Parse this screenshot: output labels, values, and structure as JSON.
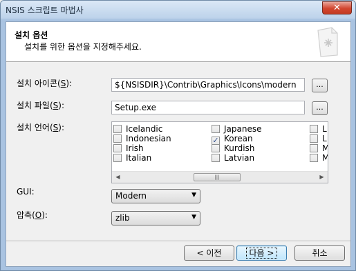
{
  "window": {
    "title": "NSIS 스크립트 마법사",
    "close_label": "✕"
  },
  "header": {
    "title": "설치 옵션",
    "subtitle": "설치를 위한 옵션을 지정해주세요."
  },
  "fields": {
    "icon": {
      "label_pre": "설치 아이콘(",
      "accel": "S",
      "label_post": "):",
      "value": "${NSISDIR}\\Contrib\\Graphics\\Icons\\modern",
      "browse": "..."
    },
    "file": {
      "label_pre": "설치 파일(",
      "accel": "S",
      "label_post": "):",
      "value": "Setup.exe",
      "browse": "..."
    },
    "language": {
      "label_pre": "설치 언어(",
      "accel": "S",
      "label_post": "):"
    },
    "gui": {
      "label": "GUI:",
      "value": "Modern"
    },
    "compress": {
      "label_pre": "압축(",
      "accel": "O",
      "label_post": "):",
      "value": "zlib"
    }
  },
  "languages": {
    "col1": [
      "Icelandic",
      "Indonesian",
      "Irish",
      "Italian"
    ],
    "col2": [
      "Japanese",
      "Korean",
      "Kurdish",
      "Latvian"
    ],
    "col3": [
      "L",
      "L",
      "M",
      "M"
    ],
    "checked": "Korean"
  },
  "buttons": {
    "back": "< 이전",
    "next": "다음 >",
    "cancel": "취소"
  },
  "icons": {
    "close": "close-icon",
    "wizard": "wizard-page-icon",
    "scroll_left": "arrow-left-icon",
    "scroll_right": "arrow-right-icon",
    "dropdown": "chevron-down-icon"
  }
}
